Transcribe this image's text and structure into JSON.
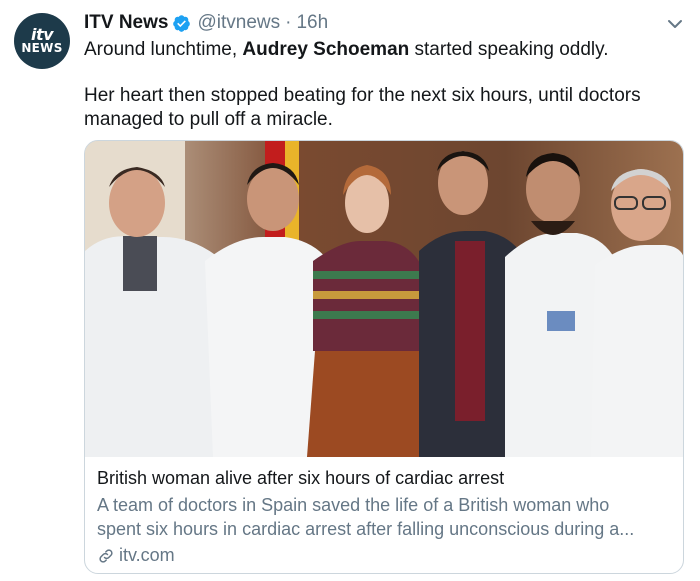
{
  "tweet": {
    "author": {
      "avatar_text": [
        "itv",
        "NEWS"
      ],
      "display_name": "ITV News",
      "verified": true,
      "handle": "@itvnews",
      "separator": "·",
      "time": "16h"
    },
    "menu_icon": "chevron-down-icon",
    "text": {
      "line1_prefix": "Around lunchtime, ",
      "line1_bold": "Audrey Schoeman",
      "line1_suffix": " started speaking oddly.",
      "line2": "Her heart then stopped beating for the next six hours, until doctors",
      "line3": "managed to pull off a miracle."
    },
    "card": {
      "image_icon": "photo",
      "title": "British woman alive after six hours of cardiac arrest",
      "description_lines": [
        "A team of doctors in Spain saved the life of a British woman who",
        "spent six hours in cardiac arrest after falling unconscious during a..."
      ],
      "link_icon": "link-icon",
      "domain": "itv.com"
    }
  },
  "colors": {
    "verified": "#1da1f2",
    "secondary_text": "#657786",
    "primary_text": "#14171a",
    "border": "#ccd6dd"
  }
}
